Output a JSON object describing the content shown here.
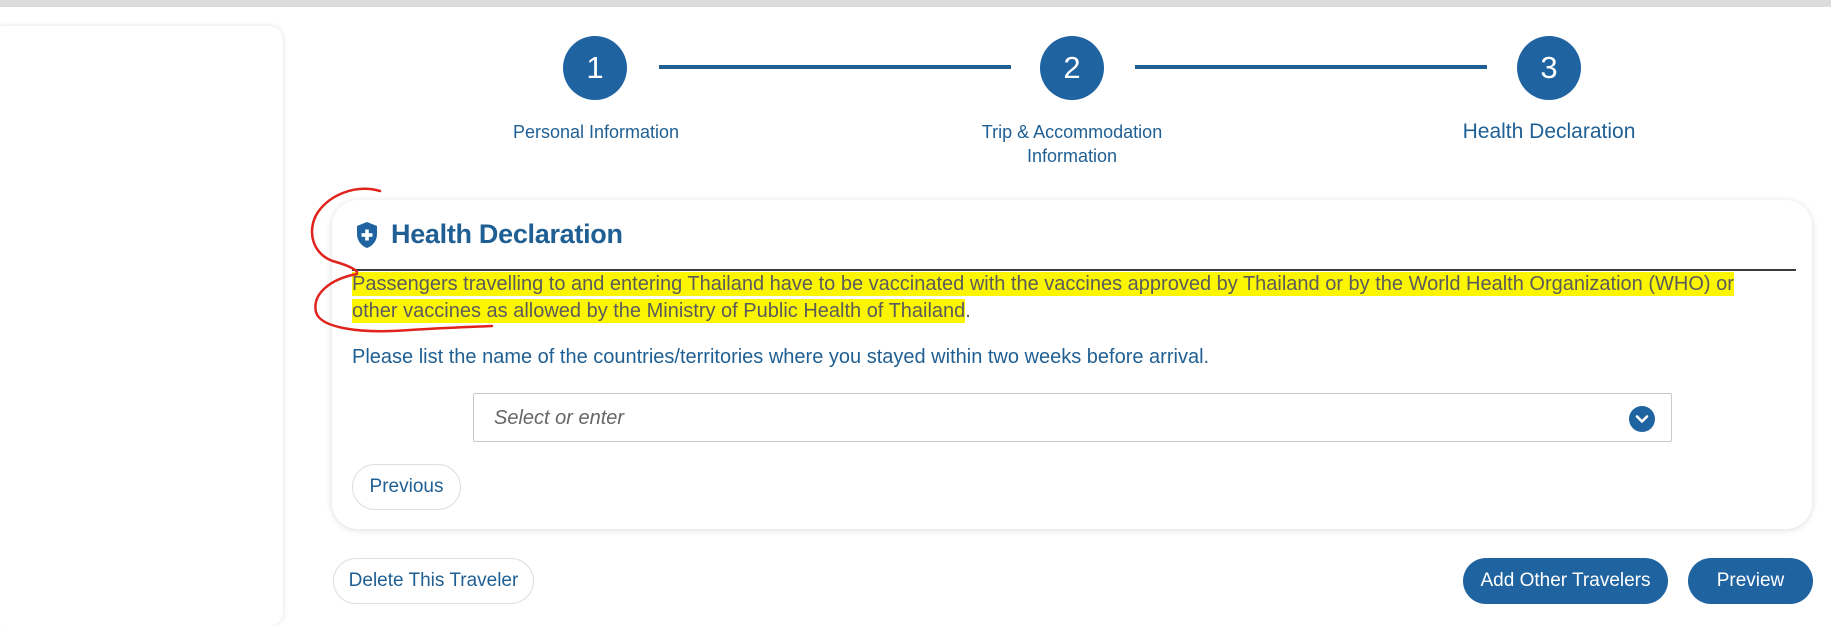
{
  "stepper": {
    "steps": [
      {
        "number": "1",
        "label": "Personal Information"
      },
      {
        "number": "2",
        "label_line1": "Trip & Accommodation",
        "label_line2": "Information"
      },
      {
        "number": "3",
        "label": "Health Declaration"
      }
    ],
    "active_step": 3
  },
  "card": {
    "icon": "shield-plus-icon",
    "title": "Health Declaration",
    "notice": {
      "line1": "Passengers travelling to and entering Thailand have to be vaccinated with the vaccines approved by Thailand or by the World Health Organization (WHO) or",
      "line2": "other vaccines as allowed by the Ministry of Public Health of Thailand",
      "line2_suffix": "."
    },
    "prompt": "Please list the name of the countries/territories where you stayed within two weeks before arrival.",
    "country_select": {
      "placeholder": "Select or enter",
      "value": ""
    },
    "previous_button": "Previous"
  },
  "footer": {
    "delete_button": "Delete This Traveler",
    "add_travelers_button": "Add Other Travelers",
    "preview_button": "Preview"
  },
  "colors": {
    "primary": "#1f63a1",
    "text_blue": "#1f5f93",
    "highlight": "#fbf600",
    "annotation_red": "#e0231c"
  }
}
